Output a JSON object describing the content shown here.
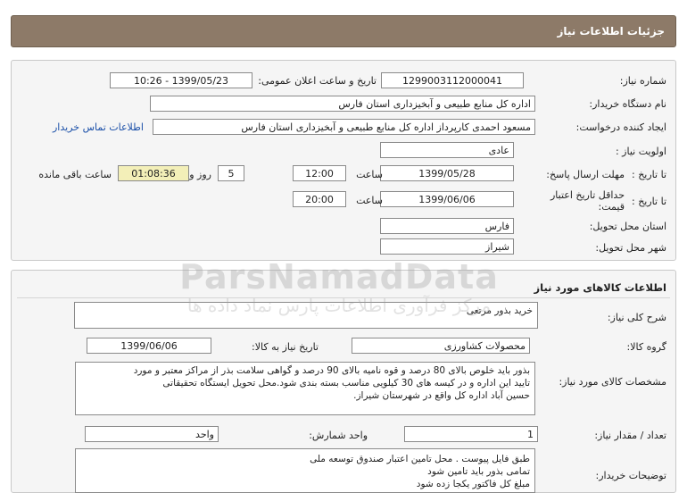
{
  "header": {
    "title": "جزئیات اطلاعات نیاز"
  },
  "need_info": {
    "need_number_label": "شماره نیاز:",
    "need_number": "1299003112000041",
    "announce_label": "تاریخ و ساعت اعلان عمومی:",
    "announce_value": "1399/05/23 - 10:26",
    "buyer_org_label": "نام دستگاه خریدار:",
    "buyer_org": "اداره کل منابع طبیعی و آبخیزداری استان فارس",
    "requester_label": "ایجاد کننده درخواست:",
    "requester": "مسعود احمدی کارپرداز اداره کل منابع طبیعی و آبخیزداری استان فارس",
    "contact_link": "اطلاعات تماس خریدار",
    "priority_label": "اولویت نیاز :",
    "priority": "عادی",
    "deadline_label": "مهلت ارسال پاسخ:",
    "until_date_label": "تا تاریخ :",
    "deadline_date": "1399/05/28",
    "time_label": "ساعت",
    "deadline_time": "12:00",
    "days_count": "5",
    "days_label": "روز و",
    "remaining_time": "01:08:36",
    "remaining_label": "ساعت باقی مانده",
    "min_validity_label": "حداقل تاریخ اعتبار قیمت:",
    "validity_until_label": "تا تاریخ :",
    "validity_date": "1399/06/06",
    "validity_time_label": "ساعت",
    "validity_time": "20:00",
    "province_label": "استان محل تحویل:",
    "province": "فارس",
    "city_label": "شهر محل تحویل:",
    "city": "شیراز"
  },
  "goods": {
    "section_title": "اطلاعات کالاهای مورد نیاز",
    "summary_label": "شرح کلی نیاز:",
    "summary": "خرید بذور مرتعی",
    "group_label": "گروه کالا:",
    "group": "محصولات کشاورزی",
    "need_date_label": "تاریخ نیاز به کالا:",
    "need_date": "1399/06/06",
    "specs_label": "مشخصات کالای مورد نیاز:",
    "specs_lines": [
      "بذور باید خلوص بالای 80 درصد و قوه نامیه بالای 90 درصد و گواهی سلامت بذر از مراکز معتبر و مورد",
      "تایید این اداره و در کیسه های 30 کیلویی مناسب بسته بندی شود.محل تحویل ایستگاه تحقیقاتی",
      "حسین آباد اداره کل واقع در شهرستان شیراز."
    ],
    "count_label": "تعداد / مقدار نیاز:",
    "count": "1",
    "unit_label": "واحد شمارش:",
    "unit": "واحد",
    "buyer_notes_label": "توضیحات خریدار:",
    "buyer_notes_lines": [
      "طبق فایل پیوست . محل تامین اعتبار صندوق توسعه ملی",
      "تمامی بذور باید تامین شود",
      "مبلغ کل فاکتور یکجا زده شود"
    ]
  },
  "watermark": {
    "brand": "ParsNamadData",
    "subtitle": "مرکز فرآوری اطلاعات پارس نماد داده ها"
  }
}
